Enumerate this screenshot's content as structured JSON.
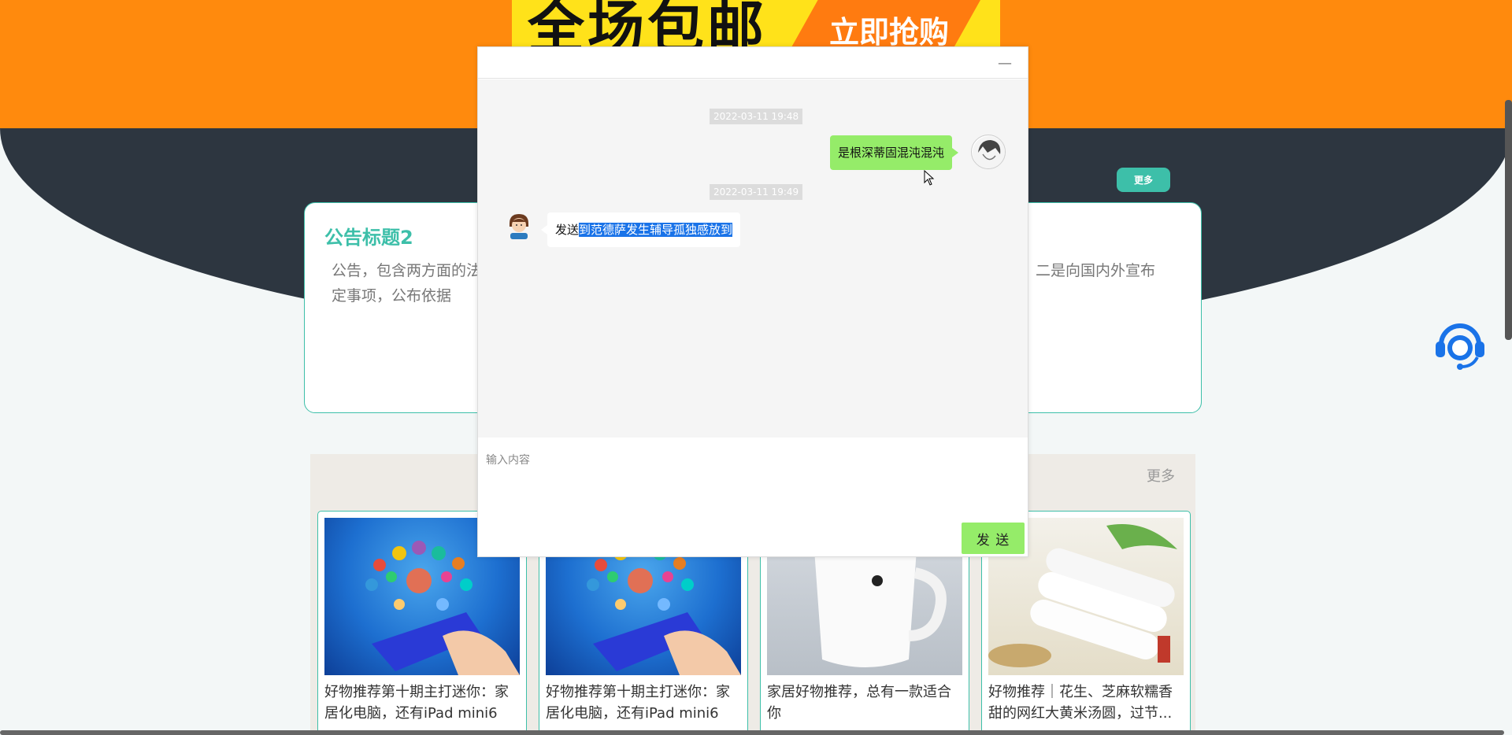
{
  "banner": {
    "headline": "全场包邮",
    "cta": "立即抢购"
  },
  "header": {
    "more_label": "更多"
  },
  "notice": {
    "title": "公告标题2",
    "text_left": "公告，包含两方面的法定事项，公布依据",
    "text_right": "二是向国内外宣布"
  },
  "products": {
    "more_label": "更多",
    "items": [
      {
        "title": "好物推荐第十期主打迷你：家居化电脑，还有iPad mini6"
      },
      {
        "title": "好物推荐第十期主打迷你：家居化电脑，还有iPad mini6"
      },
      {
        "title": "家居好物推荐，总有一款适合你"
      },
      {
        "title": "好物推荐｜花生、芝麻软糯香甜的网红大黄米汤圆，过节..."
      }
    ]
  },
  "chat": {
    "minimize_label": "—",
    "messages": [
      {
        "timestamp": "2022-03-11 19:48",
        "text": "是根深蒂固混沌混沌"
      },
      {
        "timestamp": "2022-03-11 19:49",
        "text_plain": "发送",
        "text_selected": "到范德萨发生辅导孤独感放到"
      }
    ],
    "input_placeholder": "输入内容",
    "send_label": "发 送"
  }
}
